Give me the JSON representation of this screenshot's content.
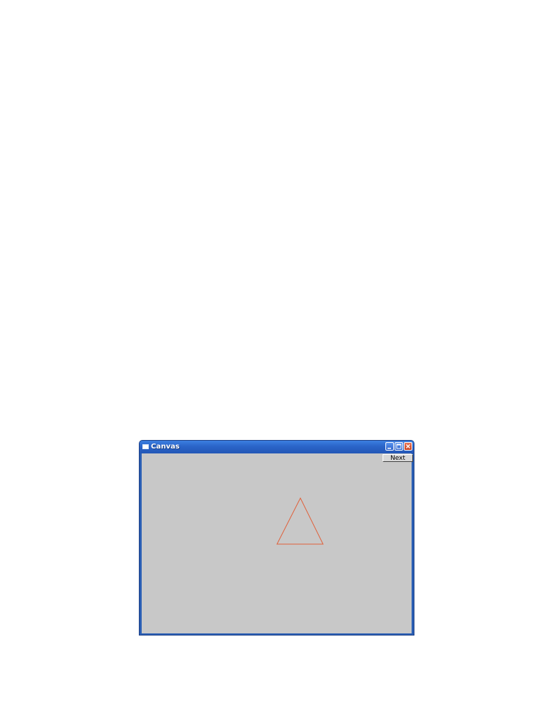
{
  "window": {
    "title": "Canvas",
    "controls": {
      "minimize_icon": "minimize-icon",
      "maximize_icon": "maximize-icon",
      "close_icon": "close-icon"
    }
  },
  "toolbar": {
    "next_label": "Next"
  },
  "canvas": {
    "background": "#c8c8c8",
    "shape": {
      "type": "triangle",
      "stroke": "#e0603a",
      "fill": "none"
    }
  },
  "colors": {
    "titlebar": "#2a64c8",
    "close_button": "#d24a28"
  }
}
